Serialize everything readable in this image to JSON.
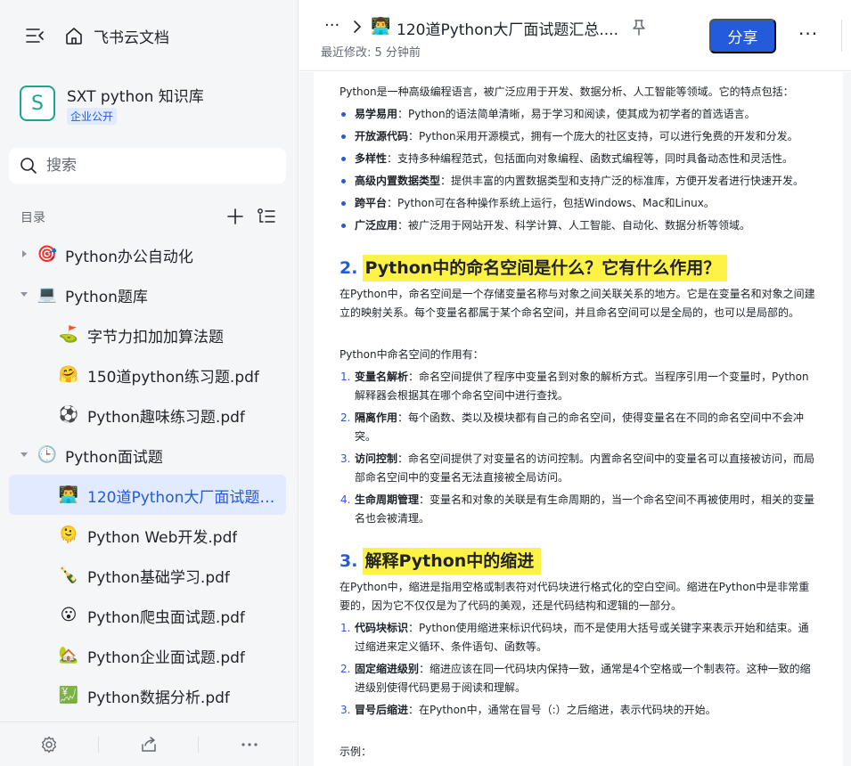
{
  "app": {
    "brand": "飞书云文档"
  },
  "space": {
    "logo_letter": "S",
    "name": "SXT python 知识库",
    "badge": "企业公开"
  },
  "search": {
    "placeholder": "搜索"
  },
  "toc": {
    "label": "目录",
    "items": [
      {
        "label": "Python办公自动化",
        "icon": "🎯",
        "level": 0,
        "expanded": false
      },
      {
        "label": "Python题库",
        "icon": "💻",
        "level": 0,
        "expanded": true
      },
      {
        "label": "字节力扣加加算法题",
        "icon": "⛳",
        "level": 1
      },
      {
        "label": "150道python练习题.pdf",
        "icon": "🤗",
        "level": 1
      },
      {
        "label": "Python趣味练习题.pdf",
        "icon": "⚽",
        "level": 1
      },
      {
        "label": "Python面试题",
        "icon": "🕒",
        "level": 0,
        "expanded": true
      },
      {
        "label": "120道Python大厂面试题汇...",
        "icon": "👨‍💻",
        "level": 1,
        "active": true
      },
      {
        "label": "Python Web开发.pdf",
        "icon": "🫠",
        "level": 1
      },
      {
        "label": "Python基础学习.pdf",
        "icon": "🍾",
        "level": 1
      },
      {
        "label": "Python爬虫面试题.pdf",
        "icon": "😮",
        "level": 1
      },
      {
        "label": "Python企业面试题.pdf",
        "icon": "🏡",
        "level": 1
      },
      {
        "label": "Python数据分析.pdf",
        "icon": "💹",
        "level": 1
      }
    ]
  },
  "header": {
    "crumb_more": "···",
    "doc_icon": "👨‍💻",
    "doc_title": "120道Python大厂面试题汇总....",
    "meta": "最近修改: 5 分钟前",
    "share_label": "分享",
    "more": "···"
  },
  "document": {
    "intro": "Python是一种高级编程语言，被广泛应用于开发、数据分析、人工智能等领域。它的特点包括：",
    "features": [
      {
        "term": "易学易用",
        "text": "：Python的语法简单清晰，易于学习和阅读，使其成为初学者的首选语言。"
      },
      {
        "term": "开放源代码",
        "text": "：Python采用开源模式，拥有一个庞大的社区支持，可以进行免费的开发和分发。"
      },
      {
        "term": "多样性",
        "text": "：支持多种编程范式，包括面向对象编程、函数式编程等，同时具备动态性和灵活性。"
      },
      {
        "term": "高级内置数据类型",
        "text": "：提供丰富的内置数据类型和支持广泛的标准库，方便开发者进行快速开发。"
      },
      {
        "term": "跨平台",
        "text": "：Python可在各种操作系统上运行，包括Windows、Mac和Linux。"
      },
      {
        "term": "广泛应用",
        "text": "：被广泛用于网站开发、科学计算、人工智能、自动化、数据分析等领域。"
      }
    ],
    "h2_num": "2.",
    "h2_text": "Python中的命名空间是什么？它有什么作用？",
    "ns_para": "在Python中，命名空间是一个存储变量名称与对象之间关联关系的地方。它是在变量名和对象之间建立的映射关系。每个变量名都属于某个命名空间，并且命名空间可以是全局的，也可以是局部的。",
    "ns_role_intro": "Python中命名空间的作用有：",
    "ns_roles": [
      {
        "num": "1.",
        "term": "变量名解析",
        "text": "：命名空间提供了程序中变量名到对象的解析方式。当程序引用一个变量时，Python解释器会根据其在哪个命名空间中进行查找。"
      },
      {
        "num": "2.",
        "term": "隔离作用",
        "text": "：每个函数、类以及模块都有自己的命名空间，使得变量名在不同的命名空间中不会冲突。"
      },
      {
        "num": "3.",
        "term": "访问控制",
        "text": "：命名空间提供了对变量名的访问控制。内置命名空间中的变量名可以直接被访问，而局部命名空间中的变量名无法直接被全局访问。"
      },
      {
        "num": "4.",
        "term": "生命周期管理",
        "text": "：变量名和对象的关联是有生命周期的，当一个命名空间不再被使用时，相关的变量名也会被清理。"
      }
    ],
    "h3_num": "3.",
    "h3_text": "解释Python中的缩进",
    "indent_para": "在Python中，缩进是指用空格或制表符对代码块进行格式化的空白空间。缩进在Python中是非常重要的，因为它不仅仅是为了代码的美观，还是代码结构和逻辑的一部分。",
    "indent_items": [
      {
        "num": "1.",
        "term": "代码块标识",
        "text": "：Python使用缩进来标识代码块，而不是使用大括号或关键字来表示开始和结束。通过缩进来定义循环、条件语句、函数等。"
      },
      {
        "num": "2.",
        "term": "固定缩进级别",
        "text": "：缩进应该在同一代码块内保持一致，通常是4个空格或一个制表符。这种一致的缩进级别使得代码更易于阅读和理解。"
      },
      {
        "num": "3.",
        "term": "冒号后缩进",
        "text": "：在Python中，通常在冒号（:）之后缩进，表示代码块的开始。"
      }
    ],
    "example_label": "示例："
  },
  "colors": {
    "accent": "#245bdb",
    "highlight": "#fff246",
    "sidebar_bg": "#f5f6f7",
    "active_bg": "#e1eaff"
  }
}
